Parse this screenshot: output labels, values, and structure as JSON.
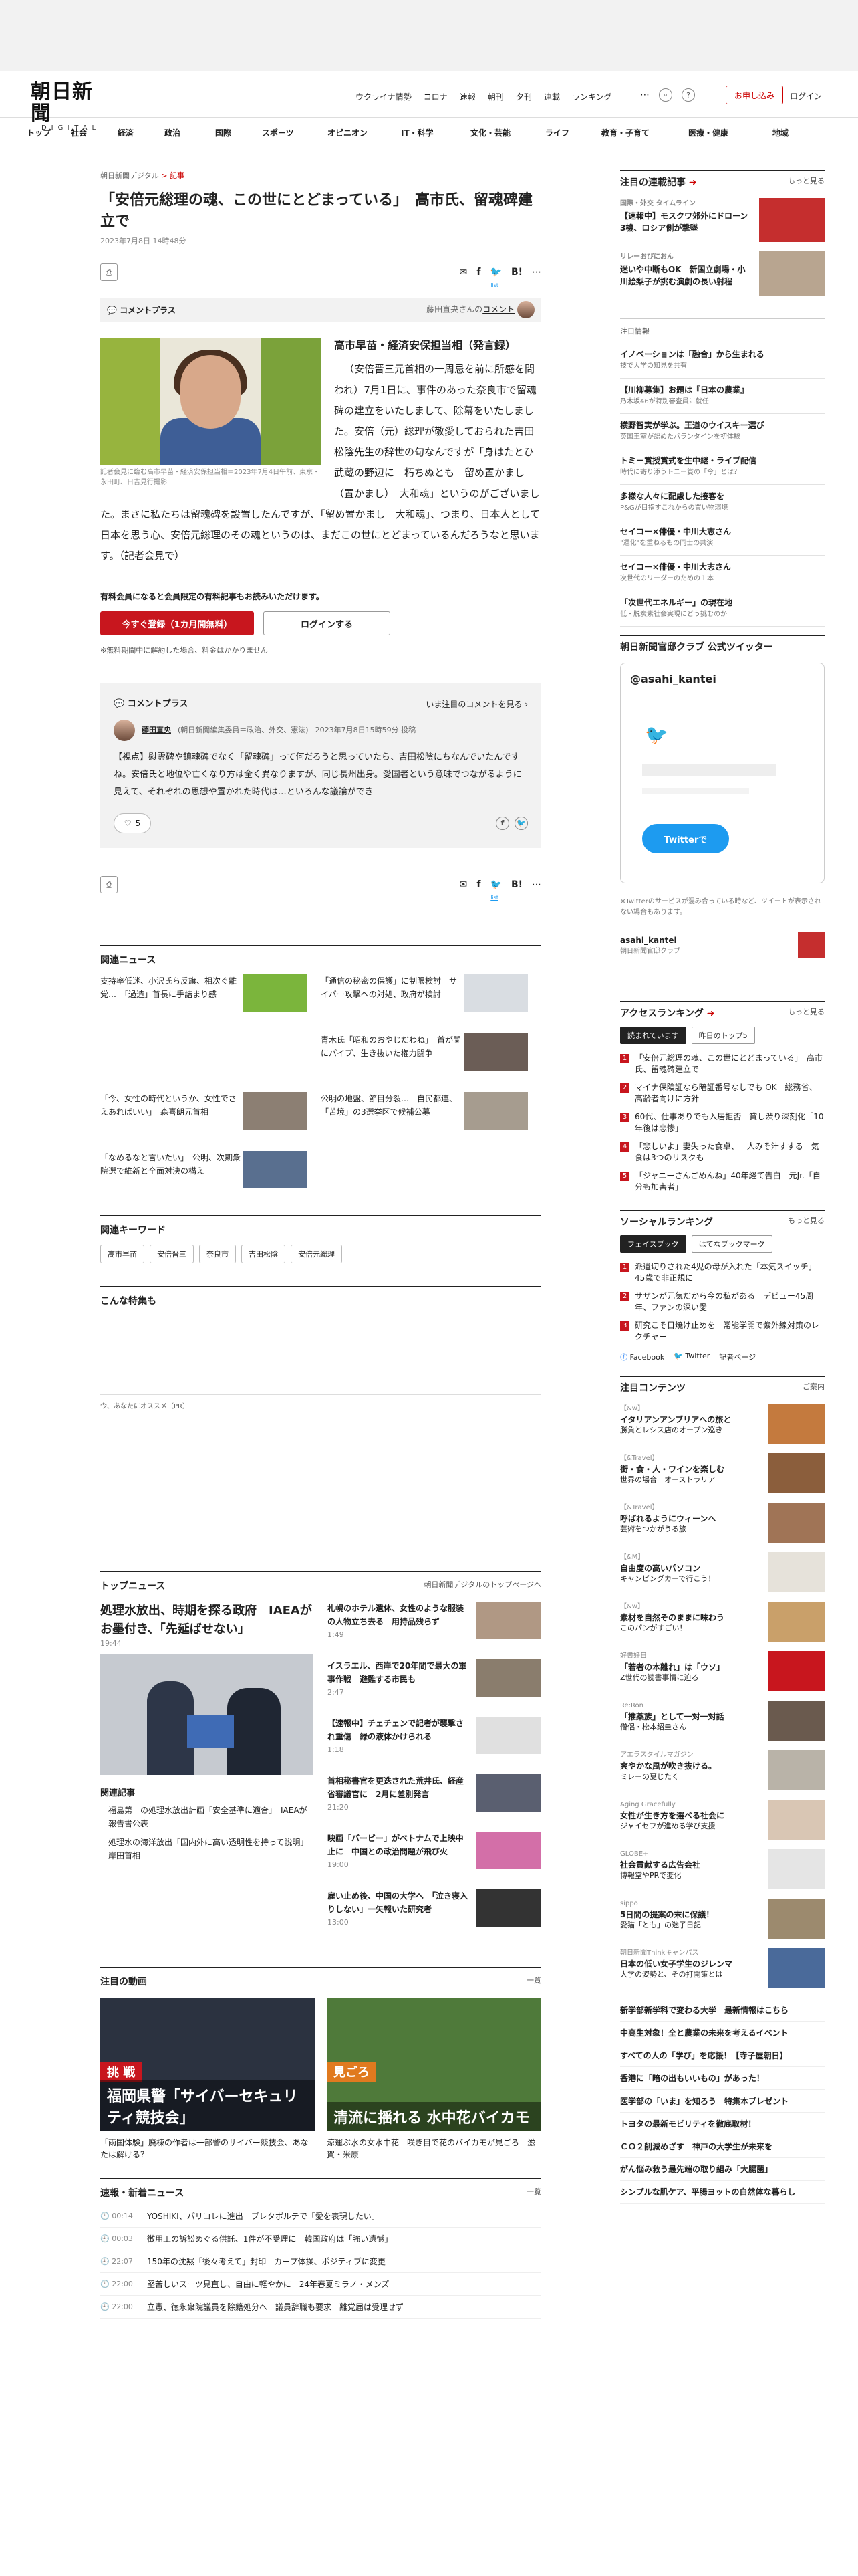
{
  "header": {
    "logo_main": "朝日新聞",
    "logo_sub": "DIGITAL",
    "nav": [
      "ウクライナ情勢",
      "コロナ",
      "速報",
      "朝刊",
      "夕刊",
      "連載",
      "ランキング"
    ],
    "register": "お申し込み",
    "login": "ログイン"
  },
  "categories": [
    "トップ",
    "社会",
    "経済",
    "政治",
    "国際",
    "スポーツ",
    "オピニオン",
    "IT・科学",
    "文化・芸能",
    "ライフ",
    "教育・子育て",
    "医療・健康",
    "地域"
  ],
  "article": {
    "breadcrumb_site": "朝日新聞デジタル",
    "breadcrumb_sep": ">",
    "breadcrumb_cat": "記事",
    "title": "「安倍元総理の魂、この世にとどまっている」　高市氏、留魂碑建立で",
    "date": "2023年7月8日 14時48分",
    "list_label": "list",
    "comment_plus": "コメントプラス",
    "commenter_ref": "藤田直央さんの",
    "comment_word": "コメント",
    "photo_caption": "記者会見に臨む高市早苗・経済安保担当相＝2023年7月4日午前、東京・永田町、日吉見行撮影",
    "subheading": "高市早苗・経済安保担当相（発言録）",
    "body": "（安倍晋三元首相の一周忌を前に所感を問われ）7月1日に、事件のあった奈良市で留魂碑の建立をいたしまして、除幕をいたしました。安倍（元）総理が敬愛しておられた吉田松陰先生の辞世の句なんですが「身はたとひ武蔵の野辺に　朽ちぬとも　留め置かまし（置かまし）　大和魂」というのがございました。まさに私たちは留魂碑を設置したんですが、「留め置かまし　大和魂」、つまり、日本人として日本を思う心、安倍元総理のその魂というのは、まだこの世にとどまっているんだろうなと思います。（記者会見で）",
    "paid_note": "有料会員になると会員限定の有料記事もお読みいただけます。",
    "btn_subscribe": "今すぐ登録（1カ月間無料）",
    "btn_login": "ログインする",
    "cancel_note": "※無料期間中に解約した場合、料金はかかりません"
  },
  "commentbox": {
    "title": "コメントプラス",
    "view_all": "いま注目のコメントを見る",
    "user": "藤田直央",
    "user_desc": "(朝日新聞編集委員＝政治、外交、憲法)",
    "user_date": "2023年7月8日15時59分 投稿",
    "text": "【視点】慰霊碑や鎮魂碑でなく「留魂碑」って何だろうと思っていたら、吉田松陰にちなんでいたんですね。安倍氏と地位や亡くなり方は全く異なりますが、同じ長州出身。愛国者という意味でつながるように見えて、それぞれの思想や置かれた時代は…といろんな議論ができ",
    "likes": "5"
  },
  "related": {
    "title": "関連ニュース",
    "items": [
      "支持率低迷、小沢氏ら反旗、相次ぐ離党…　「過造」首長に手詰まり感",
      "「通信の秘密の保護」に制限検討　サイバー攻撃への対処、政府が検討",
      "青木氏「昭和のおやじだわね」　首が関にパイプ、生き抜いた権力闘争",
      "「今、女性の時代というか、女性でさえあればいい」　森喜朗元首相",
      "公明の地盤、節目分裂…　自民都連、「苦境」の3選挙区で候補公募",
      "「なめるなと言いたい」　公明、次期衆院選で維新と全面対決の構え"
    ],
    "keywords_title": "関連キーワード",
    "keywords": [
      "高市早苗",
      "安倍晋三",
      "奈良市",
      "吉田松陰",
      "安倍元総理"
    ],
    "special_title": "こんな特集も",
    "recommend": "今、あなたにオススメ（PR）"
  },
  "topnews": {
    "title": "トップニュース",
    "link": "朝日新聞デジタルのトップページへ",
    "lead_title": "処理水放出、時期を探る政府　IAEAがお墨付き、「先延ばせない」",
    "lead_time": "19:44",
    "related_title": "関連記事",
    "related": [
      "福島第一の処理水放出計画「安全基準に適合」　IAEAが報告書公表",
      "処理水の海洋放出「国内外に高い透明性を持って説明」　岸田首相"
    ],
    "items": [
      {
        "t": "札幌のホテル遺体、女性のような服装の人物立ち去る　用持品残らず",
        "tm": "1:49"
      },
      {
        "t": "イスラエル、西岸で20年間で最大の軍事作戦　避難する市民も",
        "tm": "2:47"
      },
      {
        "t": "【速報中】チェチェンで記者が襲撃され重傷　緑の液体かけられる",
        "tm": "1:18"
      },
      {
        "t": "首相秘書官を更迭された荒井氏、経産省審議官に　2月に差別発言",
        "tm": "21:20"
      },
      {
        "t": "映画「バービー」がベトナムで上映中止に　中国との政治問題が飛び火",
        "tm": "19:00"
      },
      {
        "t": "雇い止め後、中国の大学へ　「泣き寝入りしない」一矢報いた研究者",
        "tm": "13:00"
      }
    ]
  },
  "videos": {
    "title": "注目の動画",
    "more": "一覧",
    "items": [
      {
        "tag": "挑 戦",
        "caption": "福岡県警「サイバーセキュリティ競技会」",
        "text": "「雨国体験」廃棟の作者は一部警のサイバー競技会、あなたは解ける？"
      },
      {
        "tag": "見ごろ",
        "caption": "清流に揺れる 水中花バイカモ",
        "text": "涼運ぶ水の女水中花　咲き目で花のバイカモが見ごろ　滋賀・米原"
      }
    ]
  },
  "breaking": {
    "title": "速報・新着ニュース",
    "more": "一覧",
    "items": [
      {
        "t": "00:14",
        "x": "YOSHIKI、パリコレに進出　プレタポルテで「愛を表現したい」"
      },
      {
        "t": "00:03",
        "x": "徴用工の訴訟めぐる供託、1件が不受理に　韓国政府は「強い遺憾」"
      },
      {
        "t": "22:07",
        "x": "150年の沈黙「後々考えて」封印　カープ体操、ポジティブに変更"
      },
      {
        "t": "22:00",
        "x": "堅苦しいスーツ見直し、自由に軽やかに　24年春夏ミラノ・メンズ"
      },
      {
        "t": "22:00",
        "x": "立憲、徳永衆院議員を除籍処分へ　議員辞職も要求　離党届は受理せず"
      }
    ]
  },
  "side": {
    "series_title": "注目の連載記事",
    "series_more": "もっと見る",
    "series": [
      {
        "sm": "国際・外交 タイムライン",
        "t": "【速報中】モスクワ郊外にドローン3機、ロシア側が撃墜"
      },
      {
        "sm": "リレーおぴにおん",
        "t": "迷いや中断もOK　新国立劇場・小川絵梨子が挑む演劇の長い射程"
      }
    ],
    "ad_label": "注目情報",
    "promos": [
      {
        "t": "イノベーションは「融合」から生まれる",
        "s": "技で大学の知見を共有"
      },
      {
        "t": "【川柳募集】お題は『日本の農業』",
        "s": "乃木坂46が特別審査員に就任"
      },
      {
        "t": "横野智実が学ぶ。王道のウイスキー選び",
        "s": "英国王室が認めたバランタインを初体験"
      },
      {
        "t": "トミー賞授賞式を生中継・ライブ配信",
        "s": "時代に寄り添うトニー賞の「今」とは？"
      },
      {
        "t": "多様な人々に配慮した接客を",
        "s": "P&Gが目指すこれからの買い物環境"
      },
      {
        "t": "セイコー×俳優・中川大志さん",
        "s": "\"運化\"を重ねるもの同士の共演"
      },
      {
        "t": "セイコー×俳優・中川大志さん",
        "s": "次世代のリーダーのための１本"
      },
      {
        "t": "「次世代エネルギー」の現在地",
        "s": "低・脱炭素社会実現にどう挑むのか"
      }
    ],
    "twitter_title": "朝日新聞官邸クラブ 公式ツイッター",
    "twitter_handle": "@asahi_kantei",
    "twitter_btn": "Twitterで",
    "twitter_note": "※Twitterのサービスが混み合っている時など、ツイートが表示されない場合もあります。",
    "twitter_account": "asahi_kantei",
    "twitter_account_sub": "朝日新聞官邸クラブ",
    "rank_title": "アクセスランキング",
    "rank_more": "もっと見る",
    "rank_tabs": [
      "読まれています",
      "昨日のトップ5"
    ],
    "ranks": [
      "「安倍元総理の魂、この世にとどまっている」　高市氏、留魂碑建立で",
      "マイナ保険証なら暗証番号なしでも OK　総務省、高齢者向けに方針",
      "60代、仕事ありでも入居拒否　貸し渋り深刻化「10年後は悲惨」",
      "「悲しいよ」妻失った食卓、一人みそ汁すする　気食は3つのリスクも",
      "「ジャニーさんごめんね」40年経て告白　元Jr.「自分も加害者」"
    ],
    "social_title": "ソーシャルランキング",
    "social_tabs": [
      "フェイスブック",
      "はてなブックマーク"
    ],
    "social": [
      "派遣切りされた4児の母が入れた「本気スイッチ」　45歳で非正規に",
      "サザンが元気だから今の私がある　デビュー45周年、ファンの深い愛",
      "研究こそ日焼け止めを　常能学開で紫外線対策のレクチャー"
    ],
    "social_links": [
      "Facebook",
      "Twitter",
      "記者ページ"
    ],
    "contents_title": "注目コンテンツ",
    "contents_more": "ご案内",
    "contents": [
      {
        "g": "【&w】",
        "t": "イタリアンアンブリアへの旅と",
        "s": "勝負とレシス店のオープン巡き"
      },
      {
        "g": "【&Travel】",
        "t": "街・食・人・ワインを楽しむ",
        "s": "世界の場合　オーストラリア"
      },
      {
        "g": "【&Travel】",
        "t": "呼ばれるようにウィーンへ",
        "s": "芸術をつかがうる旅"
      },
      {
        "g": "【&M】",
        "t": "自由度の高いパソコン",
        "s": "キャンピングカーで行こう！"
      },
      {
        "g": "【&w】",
        "t": "素材を自然そのままに味わう",
        "s": "このパンがすごい！"
      },
      {
        "g": "好書好日",
        "t": "「若者の本離れ」は「ウソ」",
        "s": "Z世代の読書事情に迫る"
      },
      {
        "g": "Re:Ron",
        "t": "「推薬族」として一対一対話",
        "s": "僧侶・松本紹圭さん"
      },
      {
        "g": "アエラスタイルマガジン",
        "t": "爽やかな風が吹き抜ける。",
        "s": "ミレーの夏じたく"
      },
      {
        "g": "Aging Gracefully",
        "t": "女性が生き方を選べる社会に",
        "s": "ジャイセフが進める学び支援"
      },
      {
        "g": "GLOBE+",
        "t": "社会貢献する広告会社",
        "s": "博報堂やPRで変化"
      },
      {
        "g": "sippo",
        "t": "5日間の提案の末に保護！",
        "s": "愛猫「とも」の迷子日記"
      },
      {
        "g": "朝日新聞Thinkキャンパス",
        "t": "日本の低い女子学生のジレンマ",
        "s": "大学の姿勢と、その打開策とは"
      }
    ],
    "more_links": [
      "新学部新学科で変わる大学　最新情報はこちら",
      "中高生対象！全と農業の未来を考えるイベント",
      "すべての人の「学び」を応援！【寺子屋朝日】",
      "香港に「暗の出もいいもの」があった！",
      "医学部の「いま」を知ろう　特集本プレゼント",
      "トヨタの最新モビリティを徹底取材！",
      "ＣＯ２削減めざす　神戸の大学生が未来を",
      "がん悩み救う最先端の取り組み「大腸菌」",
      "シンプルな肌ケア、平腸ヨットの自然体な暮らし"
    ]
  }
}
